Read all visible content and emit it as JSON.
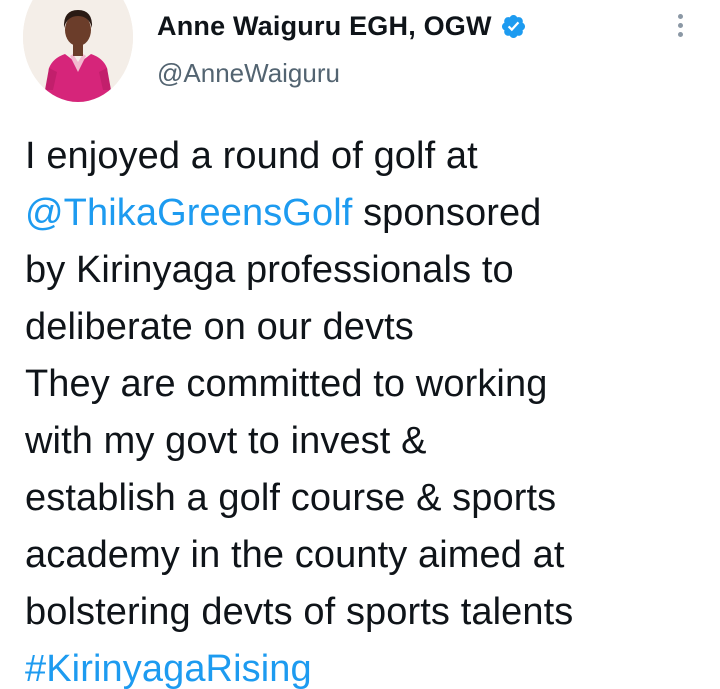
{
  "author": {
    "display_name": "Anne Waiguru EGH, OGW",
    "handle": "@AnneWaiguru",
    "verified": true,
    "avatar_icon": "profile-photo-woman-pink-jacket"
  },
  "tweet": {
    "line1": "I enjoyed a round of golf at",
    "mention": "@ThikaGreensGolf",
    "line2_rest": " sponsored",
    "line3": "by Kirinyaga professionals to",
    "line4": "deliberate on our devts",
    "line5": "They are committed to working",
    "line6": "with my govt to invest &",
    "line7": "establish a golf course & sports",
    "line8": "academy in the county aimed at",
    "line9": "bolstering devts of sports talents",
    "hashtag": "#KirinyagaRising"
  },
  "icons": {
    "more": "more-vertical-icon",
    "verified": "verified-badge-icon"
  },
  "colors": {
    "link": "#1d9bf0",
    "text": "#0f1419",
    "secondary": "#536471",
    "verified": "#1d9bf0"
  }
}
